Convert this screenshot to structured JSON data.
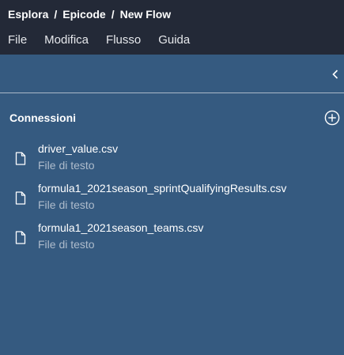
{
  "breadcrumb": {
    "items": [
      "Esplora",
      "Epicode",
      "New Flow"
    ],
    "separator": "/"
  },
  "menu": {
    "items": [
      "File",
      "Modifica",
      "Flusso",
      "Guida"
    ]
  },
  "panel": {
    "collapse_icon": "chevron-left-icon",
    "section_title": "Connessioni",
    "add_icon": "plus-circle-icon"
  },
  "connections": [
    {
      "name": "driver_value.csv",
      "type": "File di testo",
      "icon": "file-icon"
    },
    {
      "name": "formula1_2021season_sprintQualifyingResults.csv",
      "type": "File di testo",
      "icon": "file-icon"
    },
    {
      "name": "formula1_2021season_teams.csv",
      "type": "File di testo",
      "icon": "file-icon"
    }
  ],
  "colors": {
    "topbar": "#232937",
    "panel": "#355a80",
    "text_primary": "#ffffff",
    "text_secondary": "#aebccc"
  }
}
